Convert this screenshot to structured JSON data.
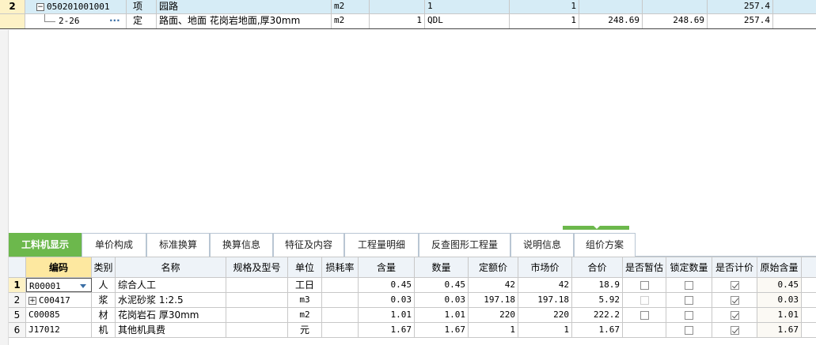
{
  "top_rows": [
    {
      "num": "2",
      "code": "050201001001",
      "type": "项",
      "name": "园路",
      "unit": "m2",
      "c5": "",
      "c6": "1",
      "c7": "1",
      "c8": "",
      "c9": "",
      "c10": "257.4"
    },
    {
      "num": "",
      "code": "2-26",
      "type": "定",
      "name": "路面、地面 花岗岩地面,厚30mm",
      "unit": "m2",
      "c5": "1",
      "c6": "QDL",
      "c7": "1",
      "c8": "248.69",
      "c9": "248.69",
      "c10": "257.4"
    }
  ],
  "dots": "···",
  "tabs": [
    "工料机显示",
    "单价构成",
    "标准换算",
    "换算信息",
    "特征及内容",
    "工程量明细",
    "反查图形工程量",
    "说明信息",
    "组价方案"
  ],
  "headers": [
    "编码",
    "类别",
    "名称",
    "规格及型号",
    "单位",
    "损耗率",
    "含量",
    "数量",
    "定额价",
    "市场价",
    "合价",
    "是否暂估",
    "锁定数量",
    "是否计价",
    "原始含量"
  ],
  "rows": [
    {
      "num": "1",
      "code": "R00001",
      "type": "人",
      "name": "综合人工",
      "spec": "",
      "unit": "工日",
      "loss": "",
      "content": "0.45",
      "qty": "0.45",
      "quota": "42",
      "market": "42",
      "total": "18.9",
      "est": "unchecked",
      "lock": "unchecked",
      "price": "checked",
      "orig": "0.45"
    },
    {
      "num": "2",
      "code": "C00417",
      "type": "浆",
      "name": "水泥砂浆 1:2.5",
      "spec": "",
      "unit": "m3",
      "loss": "",
      "content": "0.03",
      "qty": "0.03",
      "quota": "197.18",
      "market": "197.18",
      "total": "5.92",
      "est": "disabled",
      "lock": "unchecked",
      "price": "checked",
      "orig": "0.03"
    },
    {
      "num": "5",
      "code": "C00085",
      "type": "材",
      "name": "花岗岩石 厚30mm",
      "spec": "",
      "unit": "m2",
      "loss": "",
      "content": "1.01",
      "qty": "1.01",
      "quota": "220",
      "market": "220",
      "total": "222.2",
      "est": "unchecked",
      "lock": "unchecked",
      "price": "checked",
      "orig": "1.01"
    },
    {
      "num": "6",
      "code": "J17012",
      "type": "机",
      "name": "其他机具费",
      "spec": "",
      "unit": "元",
      "loss": "",
      "content": "1.67",
      "qty": "1.67",
      "quota": "1",
      "market": "1",
      "total": "1.67",
      "est": "",
      "lock": "unchecked",
      "price": "checked",
      "orig": "1.67"
    }
  ],
  "colors": {
    "selected_row": "#d6ecf6",
    "active_tab": "#6cb84c",
    "row_num_bg": "#fdf2c6",
    "header_bg": "#eef3f8",
    "code_header": "#fde8a0"
  }
}
